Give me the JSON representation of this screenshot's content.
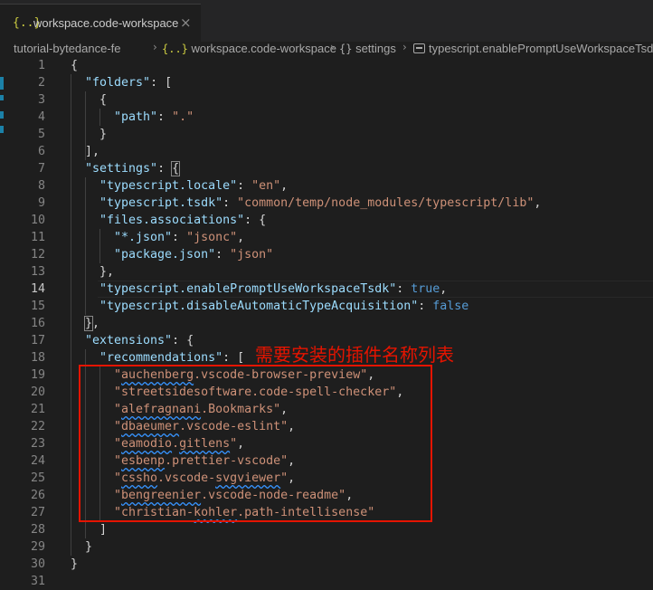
{
  "tab": {
    "icon_text": "{..}",
    "title": "workspace.code-workspace",
    "close_icon": "×"
  },
  "breadcrumb": {
    "items": [
      {
        "icon": "",
        "label": "tutorial-bytedance-fe"
      },
      {
        "icon": "{..}",
        "label": "workspace.code-workspace"
      },
      {
        "icon": "{}",
        "label": "settings"
      },
      {
        "icon": "property-icon",
        "label": "typescript.enablePromptUseWorkspaceTsdk"
      }
    ],
    "separator": "›"
  },
  "editor": {
    "active_line": 14,
    "lines": [
      [
        [
          "{",
          "punc"
        ]
      ],
      [
        [
          "\"folders\"",
          "key"
        ],
        [
          ": [",
          "punc"
        ]
      ],
      [
        [
          "{",
          "punc"
        ]
      ],
      [
        [
          "\"path\"",
          "key"
        ],
        [
          ": ",
          "punc"
        ],
        [
          "\".\"",
          "str"
        ]
      ],
      [
        [
          "}",
          "punc"
        ]
      ],
      [
        [
          "],",
          "punc"
        ]
      ],
      [
        [
          "\"settings\"",
          "key"
        ],
        [
          ": ",
          "punc"
        ],
        [
          "{",
          "punc"
        ]
      ],
      [
        [
          "\"typescript.locale\"",
          "key"
        ],
        [
          ": ",
          "punc"
        ],
        [
          "\"en\"",
          "str"
        ],
        [
          ",",
          "punc"
        ]
      ],
      [
        [
          "\"typescript.tsdk\"",
          "key"
        ],
        [
          ": ",
          "punc"
        ],
        [
          "\"common/temp/node_modules/typescript/lib\"",
          "str"
        ],
        [
          ",",
          "punc"
        ]
      ],
      [
        [
          "\"files.associations\"",
          "key"
        ],
        [
          ": {",
          "punc"
        ]
      ],
      [
        [
          "\"*.json\"",
          "key"
        ],
        [
          ": ",
          "punc"
        ],
        [
          "\"jsonc\"",
          "str"
        ],
        [
          ",",
          "punc"
        ]
      ],
      [
        [
          "\"package.json\"",
          "key"
        ],
        [
          ": ",
          "punc"
        ],
        [
          "\"json\"",
          "str"
        ]
      ],
      [
        [
          "},",
          "punc"
        ]
      ],
      [
        [
          "\"typescript.enablePromptUseWorkspaceTsdk\"",
          "key"
        ],
        [
          ": ",
          "punc"
        ],
        [
          "true",
          "bool"
        ],
        [
          ",",
          "punc"
        ]
      ],
      [
        [
          "\"typescript.disableAutomaticTypeAcquisition\"",
          "key"
        ],
        [
          ": ",
          "punc"
        ],
        [
          "false",
          "bool"
        ]
      ],
      [
        [
          "}",
          "punc"
        ],
        [
          ",",
          "punc"
        ]
      ],
      [
        [
          "\"extensions\"",
          "key"
        ],
        [
          ": {",
          "punc"
        ]
      ],
      [
        [
          "\"recommendations\"",
          "key"
        ],
        [
          ": [",
          "punc"
        ]
      ],
      [
        [
          "\"",
          "str"
        ],
        [
          "auchenberg",
          "str-sq"
        ],
        [
          ".vscode-browser-preview\"",
          "str"
        ],
        [
          ",",
          "punc"
        ]
      ],
      [
        [
          "\"streetsidesoftware.code-spell-checker\"",
          "str"
        ],
        [
          ",",
          "punc"
        ]
      ],
      [
        [
          "\"",
          "str"
        ],
        [
          "alefragnani",
          "str-sq"
        ],
        [
          ".Bookmarks\"",
          "str"
        ],
        [
          ",",
          "punc"
        ]
      ],
      [
        [
          "\"",
          "str"
        ],
        [
          "dbaeumer",
          "str-sq"
        ],
        [
          ".vscode-eslint\"",
          "str"
        ],
        [
          ",",
          "punc"
        ]
      ],
      [
        [
          "\"",
          "str"
        ],
        [
          "eamodio",
          "str-sq"
        ],
        [
          ".",
          "str"
        ],
        [
          "gitlens",
          "str-sq"
        ],
        [
          "\"",
          "str"
        ],
        [
          ",",
          "punc"
        ]
      ],
      [
        [
          "\"",
          "str"
        ],
        [
          "esbenp",
          "str-sq"
        ],
        [
          ".prettier-vscode\"",
          "str"
        ],
        [
          ",",
          "punc"
        ]
      ],
      [
        [
          "\"",
          "str"
        ],
        [
          "cssho",
          "str-sq"
        ],
        [
          ".vscode-",
          "str"
        ],
        [
          "svgviewer",
          "str-sq"
        ],
        [
          "\"",
          "str"
        ],
        [
          ",",
          "punc"
        ]
      ],
      [
        [
          "\"",
          "str"
        ],
        [
          "bengreenier",
          "str-sq"
        ],
        [
          ".vscode-node-readme\"",
          "str"
        ],
        [
          ",",
          "punc"
        ]
      ],
      [
        [
          "\"christian-",
          "str"
        ],
        [
          "kohler",
          "str-sq"
        ],
        [
          ".path-intellisense\"",
          "str"
        ]
      ],
      [
        [
          "]",
          "punc"
        ]
      ],
      [
        [
          "}",
          "punc"
        ]
      ],
      [
        [
          "}",
          "punc"
        ]
      ],
      []
    ]
  },
  "annotation": {
    "text": "需要安装的插件名称列表",
    "color": "#e51400"
  },
  "colors": {
    "background": "#1e1e1e",
    "json_key": "#9cdcfe",
    "json_string": "#ce9178",
    "json_boolean": "#569cd6",
    "line_number": "#858585",
    "json_file_icon": "#cbcb41"
  }
}
